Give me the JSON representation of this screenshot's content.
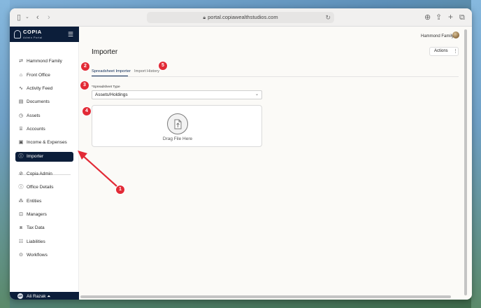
{
  "browser": {
    "url": "portal.copiawealthstudios.com"
  },
  "brand": {
    "name": "COPIA",
    "tagline": "Admin Portal",
    "navy": "#0c1e3a",
    "accent_red": "#e22a36"
  },
  "sidebar": {
    "items": [
      {
        "label": "Hammond Family",
        "icon": "swap-arrows-icon"
      },
      {
        "label": "Front Office",
        "icon": "building-icon"
      },
      {
        "label": "Activity Feed",
        "icon": "pulse-icon"
      },
      {
        "label": "Documents",
        "icon": "document-icon"
      },
      {
        "label": "Assets",
        "icon": "clock-icon"
      },
      {
        "label": "Accounts",
        "icon": "bank-icon"
      },
      {
        "label": "Income & Expenses",
        "icon": "wallet-icon"
      },
      {
        "label": "Importer",
        "icon": "info-circle-icon",
        "active": true
      }
    ],
    "items2": [
      {
        "label": "Copia Admin",
        "icon": "check-circle-icon"
      },
      {
        "label": "Office Details",
        "icon": "info-circle-icon"
      },
      {
        "label": "Entities",
        "icon": "hierarchy-icon"
      },
      {
        "label": "Managers",
        "icon": "briefcase-icon"
      },
      {
        "label": "Tax Data",
        "icon": "receipt-icon"
      },
      {
        "label": "Liabilities",
        "icon": "ledger-icon"
      },
      {
        "label": "Workflows",
        "icon": "flow-icon"
      }
    ],
    "footer": {
      "initials": "AR",
      "user": "Ali Razak ⏶"
    }
  },
  "header": {
    "user": "Hammond Family"
  },
  "main": {
    "title": "Importer",
    "actions_label": "Actions",
    "tabs": [
      {
        "label": "Spreadsheet Importer",
        "active": true
      },
      {
        "label": "Import History",
        "active": false
      }
    ],
    "field_label": "*Spreadsheet Type",
    "select_value": "Assets/Holdings",
    "dropzone_text": "Drag File Here"
  },
  "annotations": [
    "1",
    "2",
    "3",
    "4",
    "5"
  ]
}
